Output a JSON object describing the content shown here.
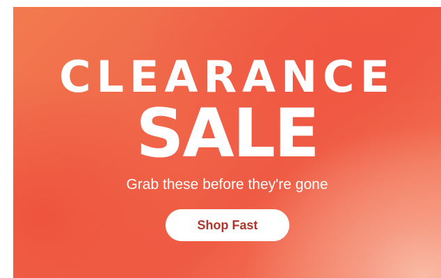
{
  "banner": {
    "headline": "CLEARANCE",
    "title": "SALE",
    "subtitle": "Grab these before they're gone",
    "cta_label": "Shop Fast",
    "colors": {
      "gradient_main": "#f0684a",
      "gradient_light": "#f8aa96",
      "text": "#ffffff",
      "button_bg": "#ffffff",
      "button_text": "#b0362a"
    }
  }
}
